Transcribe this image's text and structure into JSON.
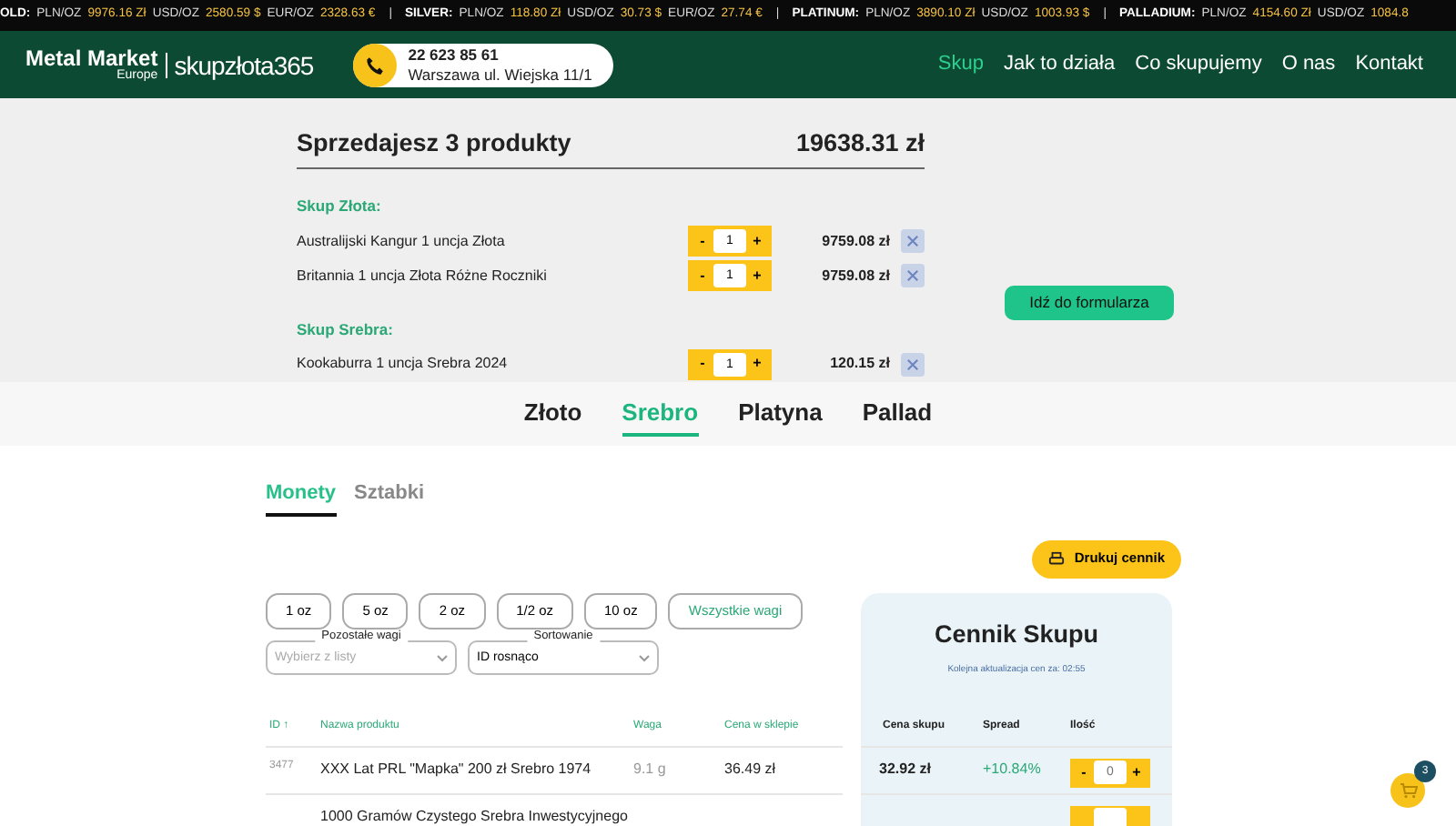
{
  "ticker": [
    {
      "metal": "OLD:",
      "quotes": [
        {
          "unit": "PLN/OZ",
          "value": "9976.16 Zł"
        },
        {
          "unit": "USD/OZ",
          "value": "2580.59 $"
        },
        {
          "unit": "EUR/OZ",
          "value": "2328.63 €"
        }
      ],
      "divider": "|"
    },
    {
      "metal": "SILVER:",
      "quotes": [
        {
          "unit": "PLN/OZ",
          "value": "118.80 Zł"
        },
        {
          "unit": "USD/OZ",
          "value": "30.73 $"
        },
        {
          "unit": "EUR/OZ",
          "value": "27.74 €"
        }
      ],
      "divider": "|"
    },
    {
      "metal": "PLATINUM:",
      "quotes": [
        {
          "unit": "PLN/OZ",
          "value": "3890.10 Zł"
        },
        {
          "unit": "USD/OZ",
          "value": "1003.93 $"
        }
      ],
      "divider": "|"
    },
    {
      "metal": "PALLADIUM:",
      "quotes": [
        {
          "unit": "PLN/OZ",
          "value": "4154.60 Zł"
        },
        {
          "unit": "USD/OZ",
          "value": "1084.8"
        }
      ]
    }
  ],
  "header": {
    "logo": {
      "name": "Metal Market",
      "sub": "Europe",
      "brand": "skupzłota365"
    },
    "contact": {
      "phone": "22 623 85 61",
      "address": "Warszawa ul. Wiejska 11/1"
    },
    "nav": [
      {
        "label": "Skup",
        "selected": true
      },
      {
        "label": "Jak to działa",
        "selected": false
      },
      {
        "label": "Co skupujemy",
        "selected": false
      },
      {
        "label": "O nas",
        "selected": false
      },
      {
        "label": "Kontakt",
        "selected": false
      }
    ]
  },
  "cart": {
    "title": "Sprzedajesz 3 produkty",
    "total": "19638.31 zł",
    "cta": "Idź do formularza",
    "groups": [
      {
        "title": "Skup Złota:",
        "items": [
          {
            "name": "Australijski Kangur 1 uncja Złota",
            "minus": "-",
            "qty": "1",
            "plus": "+",
            "price": "9759.08 zł"
          },
          {
            "name": "Britannia 1 uncja Złota Różne Roczniki",
            "minus": "-",
            "qty": "1",
            "plus": "+",
            "price": "9759.08 zł"
          }
        ]
      },
      {
        "title": "Skup Srebra:",
        "items": [
          {
            "name": "Kookaburra 1 uncja Srebra 2024",
            "minus": "-",
            "qty": "1",
            "plus": "+",
            "price": "120.15 zł"
          }
        ]
      }
    ]
  },
  "metal_tabs": [
    {
      "label": "Złoto",
      "selected": false
    },
    {
      "label": "Srebro",
      "selected": true
    },
    {
      "label": "Platyna",
      "selected": false
    },
    {
      "label": "Pallad",
      "selected": false
    }
  ],
  "sub_tabs": [
    {
      "label": "Monety",
      "selected": true
    },
    {
      "label": "Sztabki",
      "selected": false
    }
  ],
  "print_button": "Drukuj cennik",
  "weight_filters": [
    {
      "label": "1 oz",
      "selected": false
    },
    {
      "label": "5 oz",
      "selected": false
    },
    {
      "label": "2 oz",
      "selected": false
    },
    {
      "label": "1/2 oz",
      "selected": false
    },
    {
      "label": "10 oz",
      "selected": false
    },
    {
      "label": "Wszystkie wagi",
      "selected": true
    }
  ],
  "selects": [
    {
      "label": "Pozostałe wagi",
      "placeholder": "Wybierz z listy"
    },
    {
      "label": "Sortowanie",
      "value": "ID rosnąco"
    }
  ],
  "price_panel": {
    "title": "Cennik Skupu",
    "note": "Kolejna aktualizacja cen za: 02:55"
  },
  "table": {
    "columns": [
      "ID ↑",
      "Nazwa produktu",
      "Waga",
      "Cena w sklepie",
      "Cena skupu",
      "Spread",
      "Ilość"
    ],
    "rows": [
      {
        "id": "3477",
        "name": "XXX Lat PRL \"Mapka\" 200 zł Srebro 1974",
        "weight": "9.1 g",
        "shop_price": "36.49 zł",
        "buy_price": "32.92 zł",
        "spread": "+10.84%",
        "minus": "-",
        "qty_placeholder": "0",
        "plus": "+"
      },
      {
        "name": "1000 Gramów Czystego Srebra Inwestycyjnego"
      }
    ]
  },
  "cart_button": {
    "count": "3"
  }
}
